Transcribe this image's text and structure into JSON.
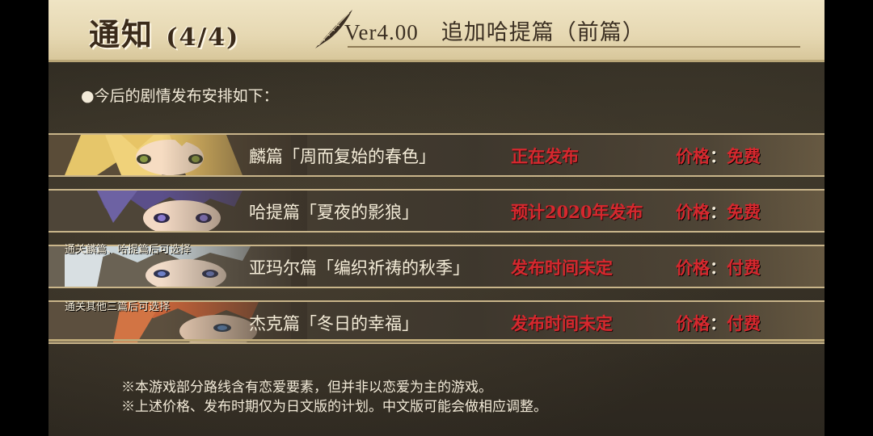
{
  "header": {
    "notice_label": "通知",
    "notice_page": "(4/4)",
    "version_title": "Ver4.00　追加哈提篇（前篇）"
  },
  "intro": "●今后的剧情发布安排如下：",
  "rows": [
    {
      "arc": "麟篇「周而复始的春色」",
      "status": "正在发布",
      "price_label": "价格",
      "price_sep": "：",
      "price": "免费",
      "condition": ""
    },
    {
      "arc": "哈提篇「夏夜的影狼」",
      "status": "预计2020年发布",
      "price_label": "价格",
      "price_sep": "：",
      "price": "免费",
      "condition": ""
    },
    {
      "arc": "亚玛尔篇「编织祈祷的秋季」",
      "status": "发布时间未定",
      "price_label": "价格",
      "price_sep": "：",
      "price": "付费",
      "condition": "通关麟篇、哈提篇后可选择"
    },
    {
      "arc": "杰克篇「冬日的幸福」",
      "status": "发布时间未定",
      "price_label": "价格",
      "price_sep": "：",
      "price": "付费",
      "condition": "通关其他三篇后可选择"
    }
  ],
  "notes": [
    "※本游戏部分路线含有恋爱要素，但并非以恋爱为主的游戏。",
    "※上述价格、发布时期仅为日文版的计划。中文版可能会做相应调整。"
  ],
  "colors": {
    "header_bg": "#efe4c4",
    "panel_bg": "#3a3428",
    "status_red": "#d6282e",
    "text_light": "#f2ead8"
  }
}
